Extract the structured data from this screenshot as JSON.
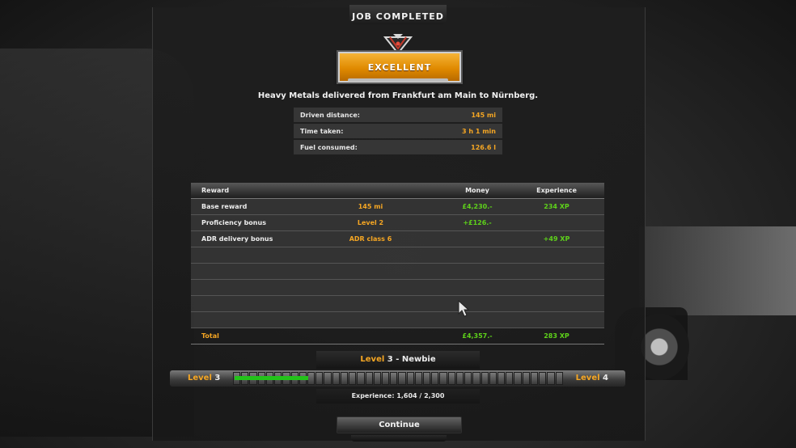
{
  "window": {
    "title": "JOB COMPLETED"
  },
  "rating": {
    "label": "EXCELLENT",
    "badge_color": "#f5a623"
  },
  "delivery_text": "Heavy Metals delivered from Frankfurt am Main to Nürnberg.",
  "stats": [
    {
      "label": "Driven distance:",
      "value": "145 mi"
    },
    {
      "label": "Time taken:",
      "value": "3 h 1 min"
    },
    {
      "label": "Fuel consumed:",
      "value": "126.6 l"
    }
  ],
  "rewards": {
    "headers": {
      "reward": "Reward",
      "money": "Money",
      "experience": "Experience"
    },
    "rows": [
      {
        "name": "Base reward",
        "detail": "145 mi",
        "money": "£4,230.-",
        "xp": "234 XP"
      },
      {
        "name": "Proficiency bonus",
        "detail": "Level 2",
        "money": "+£126.-",
        "xp": ""
      },
      {
        "name": "ADR delivery bonus",
        "detail": "ADR class 6",
        "money": "",
        "xp": "+49 XP"
      }
    ],
    "empty_rows": 5,
    "total": {
      "label": "Total",
      "money": "£4,357.-",
      "xp": "283 XP"
    }
  },
  "level": {
    "word": "Level",
    "current": "3",
    "rank": " - Newbie",
    "next": "4",
    "segments": 40,
    "progress_fraction": 0.226,
    "experience_text": "Experience: 1,604 / 2,300"
  },
  "continue_label": "Continue",
  "colors": {
    "accent": "#f5a623",
    "positive": "#5ed21a",
    "progress": "#23c31a"
  }
}
